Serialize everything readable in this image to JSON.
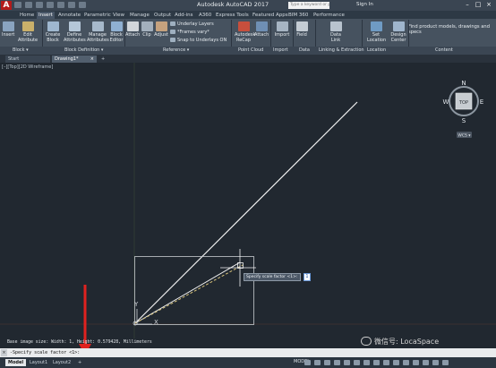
{
  "titlebar": {
    "logo": "A",
    "app_title": "Autodesk AutoCAD 2017",
    "search_placeholder": "Type a keyword or phrase",
    "sign_in": "Sign In",
    "minimize": "–",
    "maximize": "□",
    "close": "×"
  },
  "ribbon_tabs": [
    "Home",
    "Insert",
    "Annotate",
    "Parametric",
    "View",
    "Manage",
    "Output",
    "Add-ins",
    "A360",
    "Express Tools",
    "Featured Apps",
    "BIM 360",
    "Performance"
  ],
  "ribbon": {
    "insert": "Insert",
    "edit_attribute": [
      "Edit",
      "Attribute"
    ],
    "create_block": [
      "Create",
      "Block"
    ],
    "define_attributes": [
      "Define",
      "Attributes"
    ],
    "manage_attributes": [
      "Manage",
      "Attributes"
    ],
    "block_editor": [
      "Block",
      "Editor"
    ],
    "attach": "Attach",
    "clip": "Clip",
    "adjust": "Adjust",
    "underlay_layers": "Underlay Layers",
    "frames_vary": "*Frames vary*",
    "snap_underlays": "Snap to Underlays ON",
    "autodesk_recap": [
      "Autodesk",
      "ReCap"
    ],
    "attach2": "Attach",
    "import": "Import",
    "field": "Field",
    "data_link": [
      "Data",
      "Link"
    ],
    "set_location": [
      "Set",
      "Location"
    ],
    "design_center": [
      "Design",
      "Center"
    ],
    "find_content": "Find product models, drawings and specs"
  },
  "panels": [
    "Block ▾",
    "Block Definition ▾",
    "Reference ▾",
    "Point Cloud",
    "Import",
    "Data",
    "Linking & Extraction",
    "Location",
    "Content"
  ],
  "doc_tabs": {
    "start": "Start",
    "drawing": "Drawing1*",
    "close": "×",
    "add": "+"
  },
  "viewport_label": "[–][Top][2D Wireframe]",
  "viewcube": {
    "face": "TOP",
    "n": "N",
    "s": "S",
    "e": "E",
    "w": "W",
    "wcs": "WCS ▾"
  },
  "ucs": {
    "y": "Y",
    "x": "X"
  },
  "tooltip": {
    "prompt": "Specify scale factor <1>:",
    "value": "1"
  },
  "command": {
    "history": "Base image size: Width: 1, Height: 0.579428, Millimeters",
    "current": "-Specify scale factor <1>:",
    "close": "×"
  },
  "status": {
    "tabs": [
      "Model",
      "Layout1",
      "Layout2"
    ],
    "add": "+",
    "model_button": "MODEL"
  },
  "watermark": "微信号: LocaSpace",
  "colors": {
    "background": "#212830",
    "ribbon": "#46525f",
    "titlebar": "#3a4552",
    "line": "#ffffff",
    "rubber_band": "#d6c27a"
  }
}
